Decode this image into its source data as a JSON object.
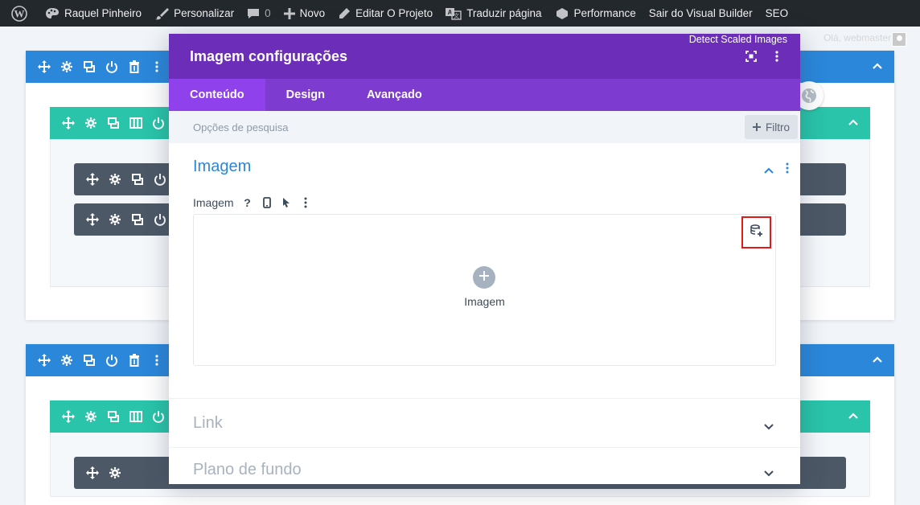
{
  "admin_bar": {
    "wp_icon": "wordpress-icon",
    "user": "Raquel Pinheiro",
    "customize": "Personalizar",
    "comments_count": "0",
    "new": "Novo",
    "edit": "Editar O Projeto",
    "translate": "Traduzir página",
    "performance": "Performance",
    "exit_vb": "Sair do Visual Builder",
    "seo": "SEO"
  },
  "account": {
    "greeting": "Olá, webmaster"
  },
  "modal": {
    "detect": "Detect Scaled Images",
    "title": "Imagem configurações",
    "tabs": [
      "Conteúdo",
      "Design",
      "Avançado"
    ],
    "search_placeholder": "Opções de pesquisa",
    "filter_label": "Filtro",
    "image_section": {
      "title": "Imagem",
      "option_label": "Imagem",
      "help": "?",
      "upload_label": "Imagem"
    },
    "link_section": {
      "title": "Link"
    },
    "background_section": {
      "title": "Plano de fundo"
    }
  },
  "colors": {
    "admin_bar": "#23282d",
    "section": "#2b87da",
    "row": "#29c4a9",
    "module": "#4c5866",
    "modal_header": "#6c2eb9",
    "modal_tabs": "#7e3bd0",
    "active_tab": "#8f42ec",
    "highlight": "#e01a1a"
  }
}
